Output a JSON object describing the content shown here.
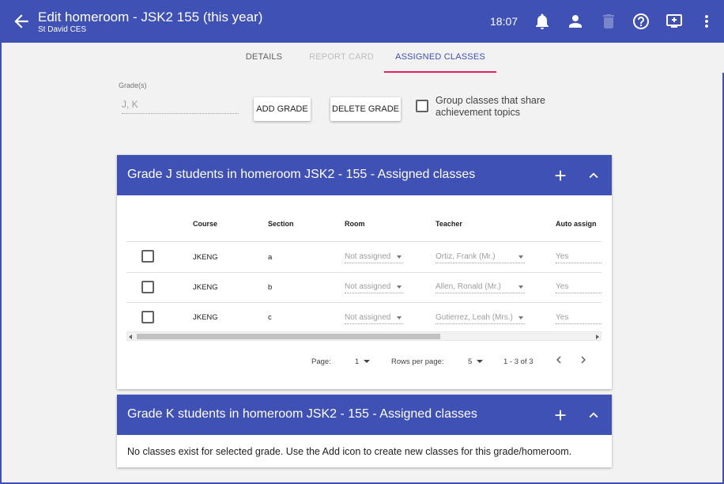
{
  "app_bar": {
    "title": "Edit homeroom - JSK2 155 (this year)",
    "subtitle": "St David CES",
    "time": "18:07",
    "icons": [
      "arrow-back-icon",
      "bell-icon",
      "person-icon",
      "trash-icon",
      "help-icon",
      "screen-share-icon",
      "more-vert-icon"
    ]
  },
  "tabs": [
    {
      "label": "DETAILS",
      "state": "normal"
    },
    {
      "label": "REPORT CARD",
      "state": "disabled"
    },
    {
      "label": "ASSIGNED CLASSES",
      "state": "active"
    }
  ],
  "grades": {
    "label": "Grade(s)",
    "value": "J, K",
    "add_label": "ADD GRADE",
    "delete_label": "DELETE GRADE",
    "group_checkbox_label": "Group classes that share achievement topics",
    "group_checked": false
  },
  "panel_j": {
    "title": "Grade J students in homeroom JSK2 - 155 - Assigned classes",
    "columns": [
      "Course",
      "Section",
      "Room",
      "Teacher",
      "Auto assign"
    ],
    "rows": [
      {
        "course": "JKENG",
        "section": "a",
        "room": "Not assigned",
        "teacher": "Ortiz, Frank (Mr.)",
        "auto": "Yes"
      },
      {
        "course": "JKENG",
        "section": "b",
        "room": "Not assigned",
        "teacher": "Allen, Ronald (Mr.)",
        "auto": "Yes"
      },
      {
        "course": "JKENG",
        "section": "c",
        "room": "Not assigned",
        "teacher": "Gutierrez, Leah (Mrs.)",
        "auto": "Yes"
      }
    ],
    "pagination": {
      "page_label": "Page:",
      "page": "1",
      "rows_label": "Rows per page:",
      "rows_per_page": "5",
      "range": "1 - 3 of 3"
    }
  },
  "panel_k": {
    "title": "Grade K students in homeroom JSK2 - 155 - Assigned classes",
    "empty_message": "No classes exist for selected grade. Use the Add icon to create new classes for this grade/homeroom."
  },
  "colors": {
    "primary": "#3f51b5",
    "tab_indicator": "#e91e63",
    "background": "#f2f2f2"
  }
}
